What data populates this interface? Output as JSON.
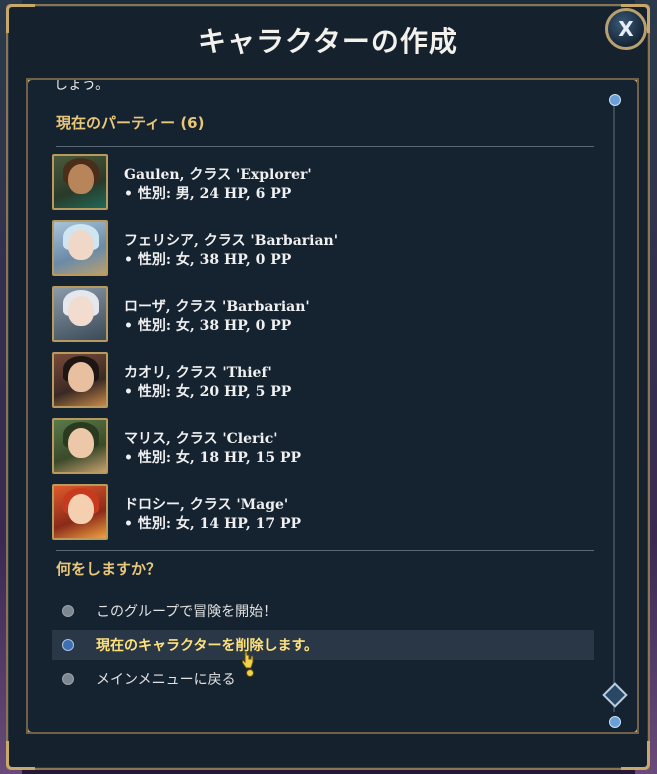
{
  "dialog": {
    "title": "キャラクターの作成",
    "close_label": "X",
    "intro_fragment": "しょう。"
  },
  "party": {
    "header": "現在のパーティー (6)",
    "members": [
      {
        "name_line": "Gaulen, クラス 'Explorer'",
        "stats_line": "• 性別: 男, 24 HP, 6 PP"
      },
      {
        "name_line": "フェリシア, クラス 'Barbarian'",
        "stats_line": "• 性別: 女, 38 HP, 0 PP"
      },
      {
        "name_line": "ローザ, クラス 'Barbarian'",
        "stats_line": "• 性別: 女, 38 HP, 0 PP"
      },
      {
        "name_line": "カオリ, クラス 'Thief'",
        "stats_line": "• 性別: 女, 20 HP, 5 PP"
      },
      {
        "name_line": "マリス, クラス 'Cleric'",
        "stats_line": "• 性別: 女, 18 HP, 15 PP"
      },
      {
        "name_line": "ドロシー, クラス 'Mage'",
        "stats_line": "• 性別: 女, 14 HP, 17 PP"
      }
    ]
  },
  "menu": {
    "question": "何をしますか？",
    "options": [
      {
        "label": "このグループで冒険を開始！"
      },
      {
        "label": "現在のキャラクターを削除します。"
      },
      {
        "label": "メインメニューに戻る"
      }
    ],
    "highlighted_index": 1
  },
  "colors": {
    "accent_gold": "#e9c77a",
    "highlight_text": "#ffe27a",
    "frame_gold": "#b89a5c"
  }
}
